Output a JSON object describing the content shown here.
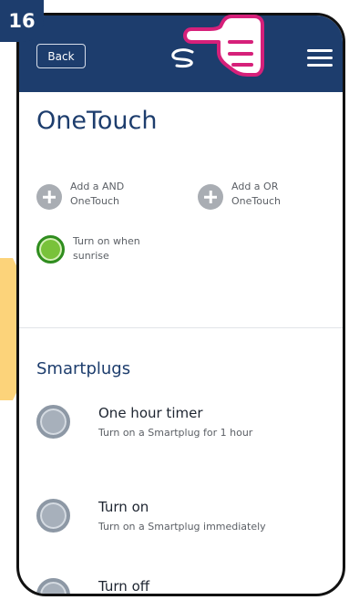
{
  "step_number": "16",
  "header": {
    "back_label": "Back"
  },
  "page_title": "OneTouch",
  "add_items": [
    {
      "label_line1": "Add a AND",
      "label_line2": "OneTouch"
    },
    {
      "label_line1": "Add a OR",
      "label_line2": "OneTouch"
    }
  ],
  "trigger": {
    "label_line1": "Turn on when",
    "label_line2": "sunrise"
  },
  "section_title": "Smartplugs",
  "smartplugs": [
    {
      "name": "One hour timer",
      "description": "Turn on a Smartplug for 1 hour"
    },
    {
      "name": "Turn on",
      "description": "Turn on a Smartplug immediately"
    },
    {
      "name": "Turn off",
      "description": ""
    }
  ],
  "colors": {
    "header_bg": "#1d3d6d",
    "accent_yellow": "#fcd37a",
    "hand_outline": "#d6207a",
    "trigger_green": "#79c23a"
  }
}
